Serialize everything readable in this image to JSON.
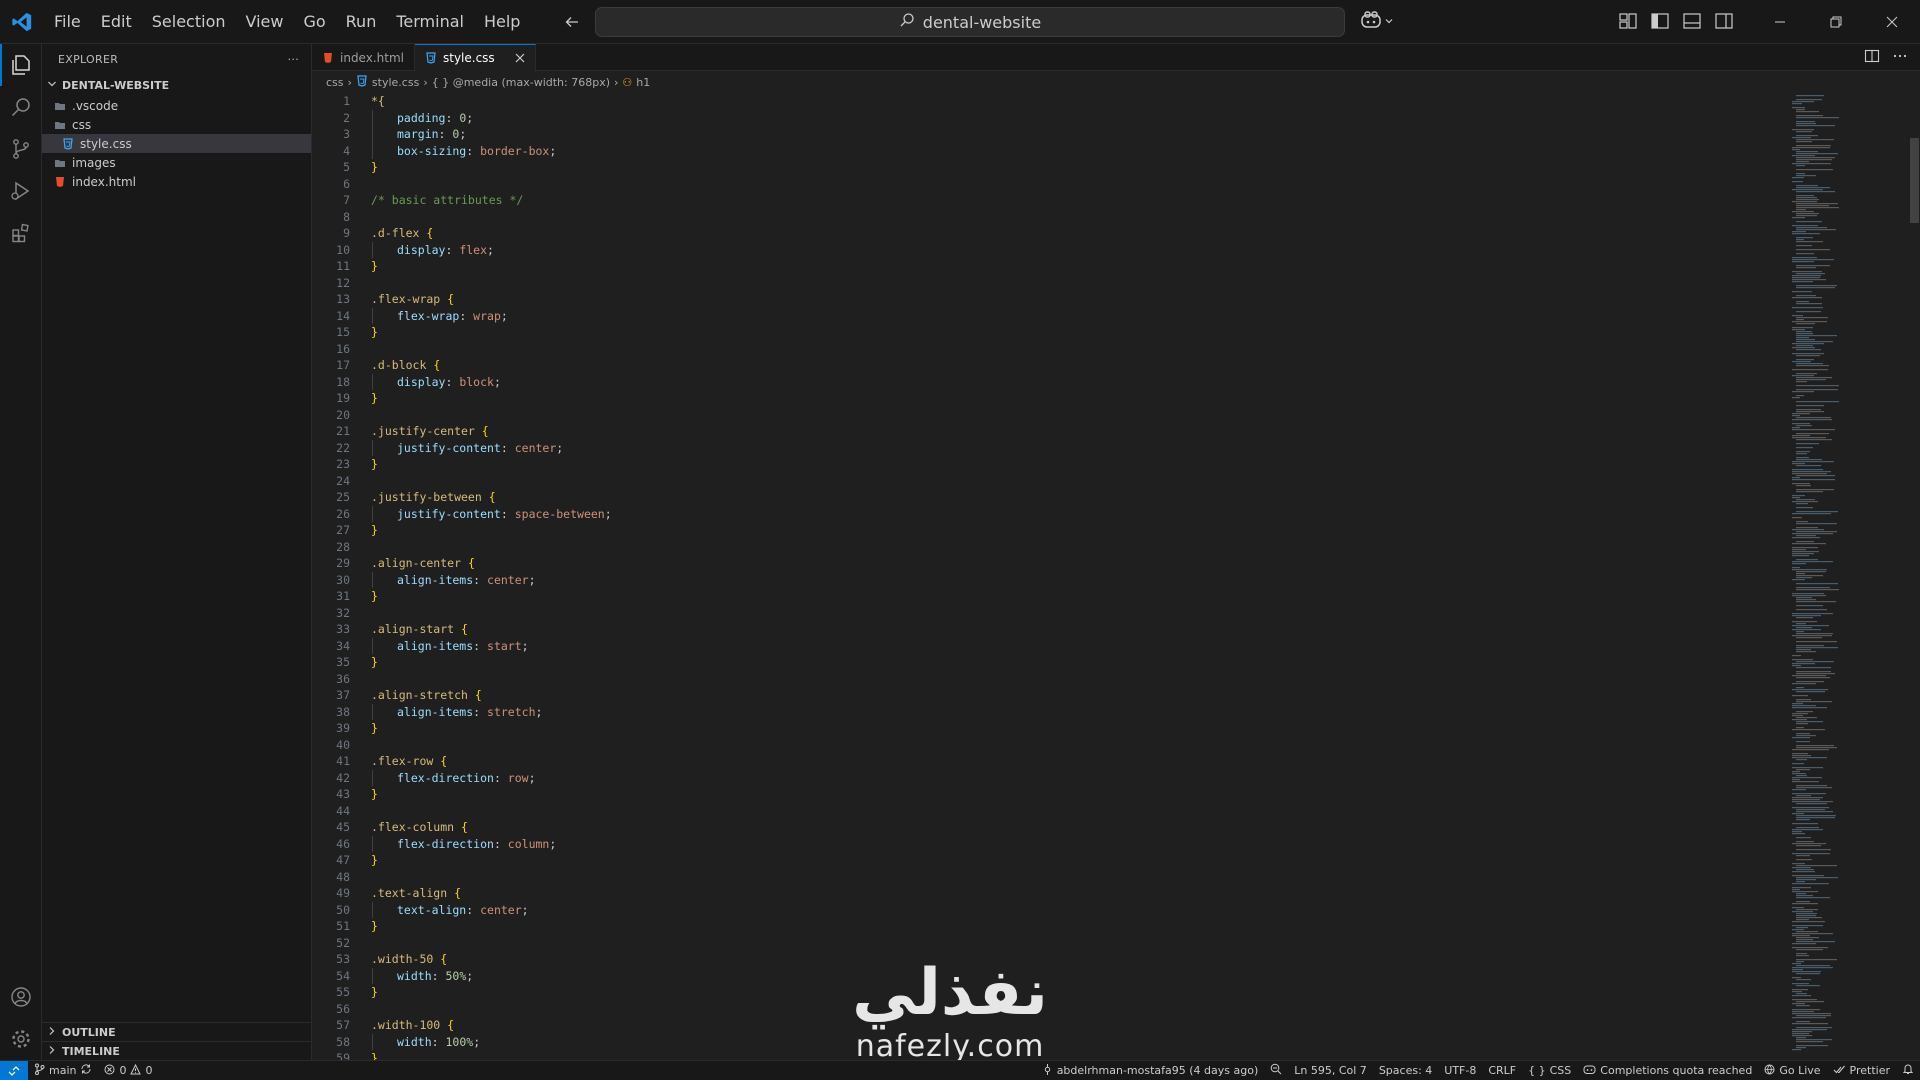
{
  "menu": [
    "File",
    "Edit",
    "Selection",
    "View",
    "Go",
    "Run",
    "Terminal",
    "Help"
  ],
  "search": {
    "text": "dental-website"
  },
  "sidebar": {
    "title": "EXPLORER",
    "more": "···",
    "root": "DENTAL-WEBSITE",
    "items": [
      {
        "label": ".vscode",
        "kind": "folder",
        "depth": 1
      },
      {
        "label": "css",
        "kind": "folder",
        "depth": 1
      },
      {
        "label": "style.css",
        "kind": "css",
        "depth": 2,
        "selected": true
      },
      {
        "label": "images",
        "kind": "folder",
        "depth": 1
      },
      {
        "label": "index.html",
        "kind": "html",
        "depth": 1
      }
    ],
    "outline": "OUTLINE",
    "timeline": "TIMELINE"
  },
  "tabs": [
    {
      "label": "index.html",
      "icon": "html-file-icon",
      "active": false
    },
    {
      "label": "style.css",
      "icon": "css-file-icon",
      "active": true
    }
  ],
  "breadcrumb": {
    "folder": "css",
    "file": "style.css",
    "media": "{ } @media (max-width: 768px)",
    "symbol": "h1"
  },
  "code": [
    [
      [
        "*{",
        "sel"
      ]
    ],
    [
      [
        "padding",
        "prop"
      ],
      [
        ": ",
        ""
      ],
      [
        "0",
        "num"
      ],
      [
        ";",
        ""
      ]
    ],
    [
      [
        "margin",
        "prop"
      ],
      [
        ": ",
        ""
      ],
      [
        "0",
        "num"
      ],
      [
        ";",
        ""
      ]
    ],
    [
      [
        "box-sizing",
        "prop"
      ],
      [
        ": ",
        ""
      ],
      [
        "border-box",
        "val"
      ],
      [
        ";",
        ""
      ]
    ],
    [
      [
        "}",
        "brace"
      ]
    ],
    [],
    [
      [
        "/* basic attributes */",
        "com"
      ]
    ],
    [],
    [
      [
        ".d-flex ",
        "sel"
      ],
      [
        "{",
        "brace"
      ]
    ],
    [
      [
        "display",
        "prop"
      ],
      [
        ": ",
        ""
      ],
      [
        "flex",
        "val"
      ],
      [
        ";",
        ""
      ]
    ],
    [
      [
        "}",
        "brace"
      ]
    ],
    [],
    [
      [
        ".flex-wrap ",
        "sel"
      ],
      [
        "{",
        "brace"
      ]
    ],
    [
      [
        "flex-wrap",
        "prop"
      ],
      [
        ": ",
        ""
      ],
      [
        "wrap",
        "val"
      ],
      [
        ";",
        ""
      ]
    ],
    [
      [
        "}",
        "brace"
      ]
    ],
    [],
    [
      [
        ".d-block ",
        "sel"
      ],
      [
        "{",
        "brace"
      ]
    ],
    [
      [
        "display",
        "prop"
      ],
      [
        ": ",
        ""
      ],
      [
        "block",
        "val"
      ],
      [
        ";",
        ""
      ]
    ],
    [
      [
        "}",
        "brace"
      ]
    ],
    [],
    [
      [
        ".justify-center ",
        "sel"
      ],
      [
        "{",
        "brace"
      ]
    ],
    [
      [
        "justify-content",
        "prop"
      ],
      [
        ": ",
        ""
      ],
      [
        "center",
        "val"
      ],
      [
        ";",
        ""
      ]
    ],
    [
      [
        "}",
        "brace"
      ]
    ],
    [],
    [
      [
        ".justify-between ",
        "sel"
      ],
      [
        "{",
        "brace"
      ]
    ],
    [
      [
        "justify-content",
        "prop"
      ],
      [
        ": ",
        ""
      ],
      [
        "space-between",
        "val"
      ],
      [
        ";",
        ""
      ]
    ],
    [
      [
        "}",
        "brace"
      ]
    ],
    [],
    [
      [
        ".align-center ",
        "sel"
      ],
      [
        "{",
        "brace"
      ]
    ],
    [
      [
        "align-items",
        "prop"
      ],
      [
        ": ",
        ""
      ],
      [
        "center",
        "val"
      ],
      [
        ";",
        ""
      ]
    ],
    [
      [
        "}",
        "brace"
      ]
    ],
    [],
    [
      [
        ".align-start ",
        "sel"
      ],
      [
        "{",
        "brace"
      ]
    ],
    [
      [
        "align-items",
        "prop"
      ],
      [
        ": ",
        ""
      ],
      [
        "start",
        "val"
      ],
      [
        ";",
        ""
      ]
    ],
    [
      [
        "}",
        "brace"
      ]
    ],
    [],
    [
      [
        ".align-stretch ",
        "sel"
      ],
      [
        "{",
        "brace"
      ]
    ],
    [
      [
        "align-items",
        "prop"
      ],
      [
        ": ",
        ""
      ],
      [
        "stretch",
        "val"
      ],
      [
        ";",
        ""
      ]
    ],
    [
      [
        "}",
        "brace"
      ]
    ],
    [],
    [
      [
        ".flex-row ",
        "sel"
      ],
      [
        "{",
        "brace"
      ]
    ],
    [
      [
        "flex-direction",
        "prop"
      ],
      [
        ": ",
        ""
      ],
      [
        "row",
        "val"
      ],
      [
        ";",
        ""
      ]
    ],
    [
      [
        "}",
        "brace"
      ]
    ],
    [],
    [
      [
        ".flex-column ",
        "sel"
      ],
      [
        "{",
        "brace"
      ]
    ],
    [
      [
        "flex-direction",
        "prop"
      ],
      [
        ": ",
        ""
      ],
      [
        "column",
        "val"
      ],
      [
        ";",
        ""
      ]
    ],
    [
      [
        "}",
        "brace"
      ]
    ],
    [],
    [
      [
        ".text-align ",
        "sel"
      ],
      [
        "{",
        "brace"
      ]
    ],
    [
      [
        "text-align",
        "prop"
      ],
      [
        ": ",
        ""
      ],
      [
        "center",
        "val"
      ],
      [
        ";",
        ""
      ]
    ],
    [
      [
        "}",
        "brace"
      ]
    ],
    [],
    [
      [
        ".width-50 ",
        "sel"
      ],
      [
        "{",
        "brace"
      ]
    ],
    [
      [
        "width",
        "prop"
      ],
      [
        ": ",
        ""
      ],
      [
        "50%",
        "num"
      ],
      [
        ";",
        ""
      ]
    ],
    [
      [
        "}",
        "brace"
      ]
    ],
    [],
    [
      [
        ".width-100 ",
        "sel"
      ],
      [
        "{",
        "brace"
      ]
    ],
    [
      [
        "width",
        "prop"
      ],
      [
        ": ",
        ""
      ],
      [
        "100%",
        "num"
      ],
      [
        ";",
        ""
      ]
    ],
    [
      [
        "}",
        "brace"
      ]
    ]
  ],
  "watermark": {
    "arabic": "نفذلي",
    "latin": "nafezly.com"
  },
  "status": {
    "branch": "main",
    "errors": "0",
    "warnings": "0",
    "blame": "abdelrhman-mostafa95 (4 days ago)",
    "position": "Ln 595, Col 7",
    "spaces": "Spaces: 4",
    "encoding": "UTF-8",
    "eol": "CRLF",
    "language": "CSS",
    "copilot": "Completions quota reached",
    "golive": "Go Live",
    "prettier": "Prettier"
  },
  "colors": {
    "accent": "#0078d4",
    "background": "#1f1f1f",
    "chrome": "#181818"
  }
}
